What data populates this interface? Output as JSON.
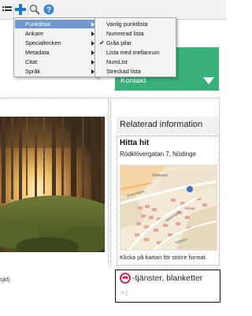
{
  "toolbar": {
    "icons": [
      "list-icon",
      "plus-icon",
      "zoom-icon",
      "help-icon"
    ]
  },
  "main_menu": {
    "items": [
      {
        "label": "Punktlista",
        "has_submenu": true,
        "active": true
      },
      {
        "label": "Ankare",
        "has_submenu": true
      },
      {
        "label": "Specialtecken",
        "has_submenu": true
      },
      {
        "label": "Metadata",
        "has_submenu": true
      },
      {
        "label": "Citat",
        "has_submenu": true
      },
      {
        "label": "Språk",
        "has_submenu": true
      }
    ]
  },
  "sub_menu": {
    "items": [
      {
        "label": "Vanlig punktlista"
      },
      {
        "label": "Numrerad lista"
      },
      {
        "label": "Gråa pilar",
        "checked": true
      },
      {
        "label": "Lista med mellanrum"
      },
      {
        "label": "NumList"
      },
      {
        "label": "Streckad lista"
      }
    ]
  },
  "contact": {
    "label": "Kontakt",
    "color": "#39b07a"
  },
  "related": {
    "title": "Relaterad information"
  },
  "hitta": {
    "title": "Hitta hit",
    "address": "Rödklövergatan 7, Nödinge",
    "map_caption": "Klicka på kartan för större format.",
    "map_labels": [
      "Nolesant",
      "Svarsvägen",
      "Hjälpvägen",
      "Klöver",
      "Tallbiten"
    ]
  },
  "etjanster": {
    "label": "-tjänster, blanketter",
    "input_value": "> |"
  },
  "side_text": "sjkfj"
}
